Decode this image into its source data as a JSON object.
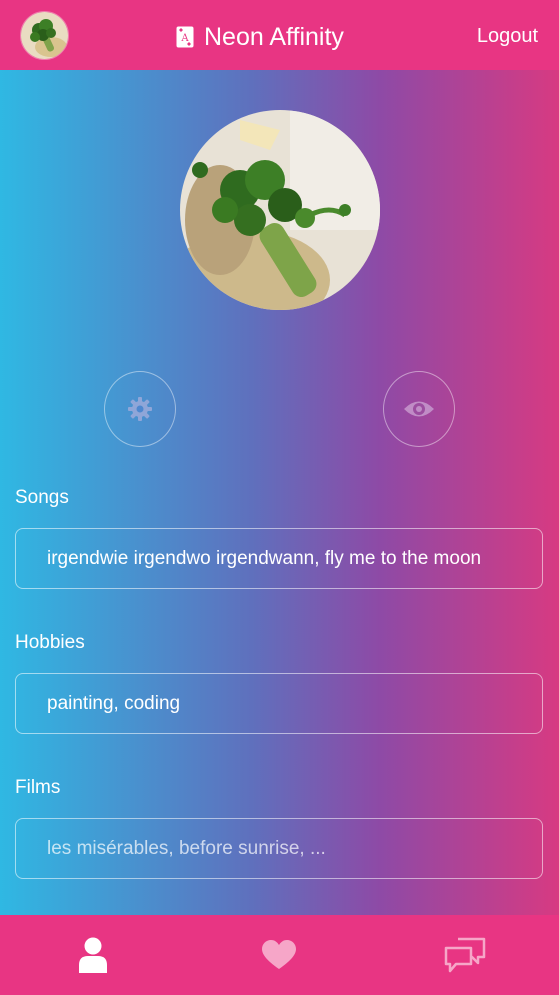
{
  "header": {
    "app_title": "Neon Affinity",
    "logout_label": "Logout",
    "brand_icon": "ace-of-spades-card-icon",
    "avatar": "user-avatar-broccoli-photo"
  },
  "profile": {
    "photo": "profile-photo-broccoli",
    "actions": [
      {
        "icon": "gear-icon",
        "purpose": "settings"
      },
      {
        "icon": "eye-icon",
        "purpose": "preview"
      }
    ]
  },
  "fields": {
    "songs": {
      "label": "Songs",
      "value": "irgendwie irgendwo irgendwann, fly me to the moon",
      "placeholder": ""
    },
    "hobbies": {
      "label": "Hobbies",
      "value": "painting, coding",
      "placeholder": ""
    },
    "films": {
      "label": "Films",
      "value": "",
      "placeholder": "les misérables, before sunrise, ..."
    }
  },
  "bottom_nav": [
    {
      "icon": "user-icon",
      "active": true
    },
    {
      "icon": "heart-icon",
      "active": false
    },
    {
      "icon": "chat-bubbles-icon",
      "active": false
    }
  ],
  "colors": {
    "bar": "#e83583",
    "gradient_left": "#2fb8e3",
    "gradient_mid": "#5f70bd",
    "gradient_right": "#d73a82",
    "inactive_icon": "#f6a6c8"
  }
}
